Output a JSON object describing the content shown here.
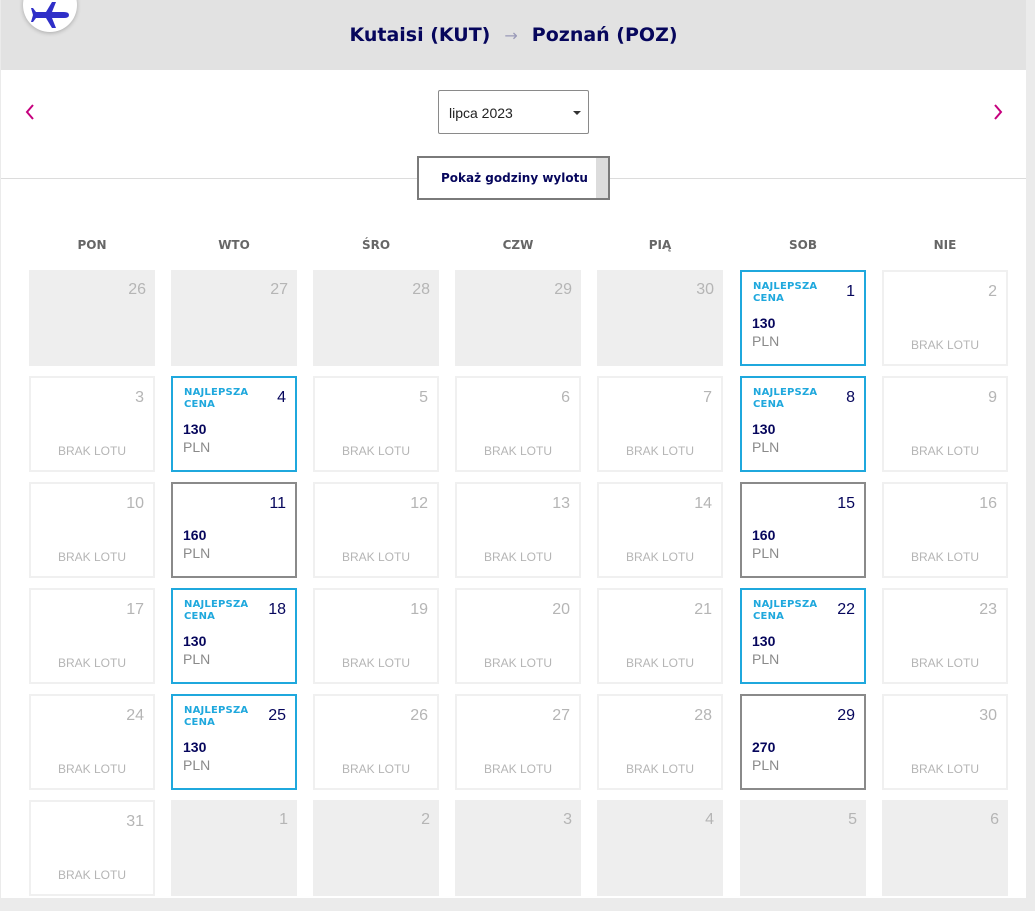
{
  "route": {
    "from": "Kutaisi (KUT)",
    "arrow": "→",
    "to": "Poznań (POZ)"
  },
  "icons": {
    "plane": "airplane-icon",
    "prev": "chevron-left-icon",
    "next": "chevron-right-icon",
    "dropdown": "caret-down-icon"
  },
  "colors": {
    "brand_navy": "#06065c",
    "accent_magenta": "#c6007e",
    "best_price_blue": "#1fa8dd",
    "plane_purple": "#2f2fc8"
  },
  "month_select": {
    "value": "lipca 2023"
  },
  "show_times_button": {
    "label": "Pokaż godziny wylotu"
  },
  "labels": {
    "best": "NAJLEPSZA\nCENA",
    "no_flight": "BRAK LOTU",
    "currency": "PLN"
  },
  "weekdays": [
    "PON",
    "WTO",
    "ŚRO",
    "CZW",
    "PIĄ",
    "SOB",
    "NIE"
  ],
  "calendar": [
    [
      {
        "day": "26",
        "status": "other"
      },
      {
        "day": "27",
        "status": "other"
      },
      {
        "day": "28",
        "status": "other"
      },
      {
        "day": "29",
        "status": "other"
      },
      {
        "day": "30",
        "status": "other"
      },
      {
        "day": "1",
        "status": "best",
        "price": "130"
      },
      {
        "day": "2",
        "status": "none"
      }
    ],
    [
      {
        "day": "3",
        "status": "none"
      },
      {
        "day": "4",
        "status": "best",
        "price": "130"
      },
      {
        "day": "5",
        "status": "none"
      },
      {
        "day": "6",
        "status": "none"
      },
      {
        "day": "7",
        "status": "none"
      },
      {
        "day": "8",
        "status": "best",
        "price": "130"
      },
      {
        "day": "9",
        "status": "none"
      }
    ],
    [
      {
        "day": "10",
        "status": "none"
      },
      {
        "day": "11",
        "status": "fare",
        "price": "160"
      },
      {
        "day": "12",
        "status": "none"
      },
      {
        "day": "13",
        "status": "none"
      },
      {
        "day": "14",
        "status": "none"
      },
      {
        "day": "15",
        "status": "fare",
        "price": "160"
      },
      {
        "day": "16",
        "status": "none"
      }
    ],
    [
      {
        "day": "17",
        "status": "none"
      },
      {
        "day": "18",
        "status": "best",
        "price": "130"
      },
      {
        "day": "19",
        "status": "none"
      },
      {
        "day": "20",
        "status": "none"
      },
      {
        "day": "21",
        "status": "none"
      },
      {
        "day": "22",
        "status": "best",
        "price": "130"
      },
      {
        "day": "23",
        "status": "none"
      }
    ],
    [
      {
        "day": "24",
        "status": "none"
      },
      {
        "day": "25",
        "status": "best",
        "price": "130"
      },
      {
        "day": "26",
        "status": "none"
      },
      {
        "day": "27",
        "status": "none"
      },
      {
        "day": "28",
        "status": "none"
      },
      {
        "day": "29",
        "status": "fare",
        "price": "270"
      },
      {
        "day": "30",
        "status": "none"
      }
    ],
    [
      {
        "day": "31",
        "status": "none"
      },
      {
        "day": "1",
        "status": "other"
      },
      {
        "day": "2",
        "status": "other"
      },
      {
        "day": "3",
        "status": "other"
      },
      {
        "day": "4",
        "status": "other"
      },
      {
        "day": "5",
        "status": "other"
      },
      {
        "day": "6",
        "status": "other"
      }
    ]
  ]
}
